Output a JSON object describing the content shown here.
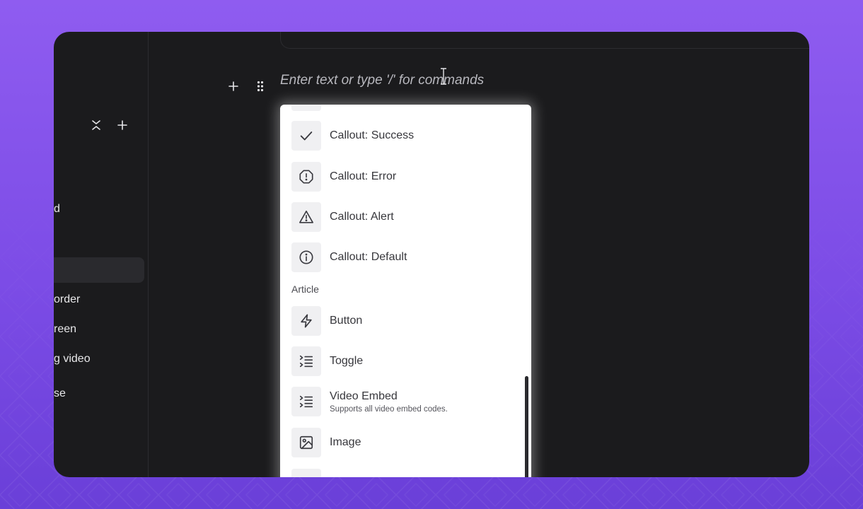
{
  "editor": {
    "placeholder": "Enter text or type '/' for commands"
  },
  "sidebar": {
    "items": [
      {
        "label": "d",
        "top": 0
      },
      {
        "label": ""
      },
      {
        "label": "order"
      },
      {
        "label": "reen"
      },
      {
        "label": "g video"
      },
      {
        "label": "se"
      }
    ]
  },
  "menu": {
    "items": [
      {
        "label": "Callout: Success",
        "icon": "check-icon"
      },
      {
        "label": "Callout: Error",
        "icon": "octagon-alert-icon"
      },
      {
        "label": "Callout: Alert",
        "icon": "triangle-alert-icon"
      },
      {
        "label": "Callout: Default",
        "icon": "info-icon"
      }
    ],
    "section_article": "Article",
    "article_items": [
      {
        "label": "Button",
        "icon": "lightning-icon"
      },
      {
        "label": "Toggle",
        "icon": "list-toggle-icon"
      },
      {
        "label": "Video Embed",
        "description": "Supports all video embed codes.",
        "icon": "list-toggle-icon"
      },
      {
        "label": "Image",
        "icon": "image-icon"
      }
    ]
  },
  "colors": {
    "background": "#8f5cf0",
    "window": "#1b1b1d",
    "menu": "#ffffff",
    "icon_box": "#f0f0f2"
  }
}
